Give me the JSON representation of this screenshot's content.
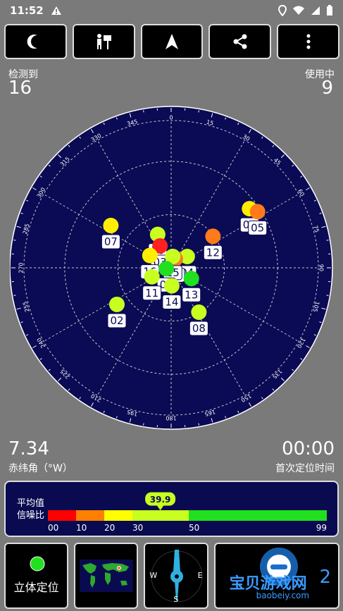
{
  "status": {
    "time": "11:52"
  },
  "stats": {
    "detected_label": "检测到",
    "detected_value": "16",
    "used_label": "使用中",
    "used_value": "9",
    "declination_value": "7.34",
    "declination_label": "赤纬角（°W）",
    "ttff_value": "00:00",
    "ttff_label": "首次定位时间"
  },
  "compass": {
    "labels": [
      "0",
      "15",
      "30",
      "45",
      "60",
      "75",
      "90",
      "105",
      "120",
      "135",
      "150",
      "165",
      "180",
      "195",
      "210",
      "225",
      "240",
      "255",
      "270",
      "285",
      "300",
      "315",
      "330",
      "345"
    ]
  },
  "satellites": [
    {
      "id": "07",
      "az": 305,
      "el": 45,
      "color": "#ffee00"
    },
    {
      "id": "09",
      "az": 53,
      "el": 30,
      "color": "#ffee00"
    },
    {
      "id": "05",
      "az": 57,
      "el": 27,
      "color": "#ff7a1a"
    },
    {
      "id": "10",
      "az": 338,
      "el": 68,
      "color": "#c8ff20"
    },
    {
      "id": "03",
      "az": 333,
      "el": 75,
      "color": "#ff2020"
    },
    {
      "id": "16",
      "az": 300,
      "el": 75,
      "color": "#ffee00"
    },
    {
      "id": "12",
      "az": 53,
      "el": 58,
      "color": "#ff7a1a"
    },
    {
      "id": "04",
      "az": 55,
      "el": 78,
      "color": "#c8ff20"
    },
    {
      "id": "06",
      "az": 25,
      "el": 84,
      "color": "#ff7a1a"
    },
    {
      "id": "15",
      "az": 8,
      "el": 83,
      "color": "#c8ff20"
    },
    {
      "id": "01",
      "az": 260,
      "el": 87,
      "color": "#20e020"
    },
    {
      "id": "11",
      "az": 245,
      "el": 77,
      "color": "#c8ff20"
    },
    {
      "id": "14",
      "az": 178,
      "el": 79,
      "color": "#c8ff20"
    },
    {
      "id": "13",
      "az": 118,
      "el": 76,
      "color": "#20e020"
    },
    {
      "id": "08",
      "az": 148,
      "el": 58,
      "color": "#c8ff20"
    },
    {
      "id": "02",
      "az": 236,
      "el": 50,
      "color": "#c8ff20"
    }
  ],
  "snr": {
    "title_line1": "平均值",
    "title_line2": "信噪比",
    "average": "39.9",
    "ticks": [
      "00",
      "10",
      "20",
      "30",
      "50",
      "99"
    ],
    "colors": [
      "#ff0000",
      "#ff8000",
      "#ffff00",
      "#c8ff20",
      "#20e020"
    ]
  },
  "bottom": {
    "stereo_label": "立体定位",
    "compass_w": "W",
    "compass_e": "E",
    "compass_s": "S",
    "watermark_text": "宝贝游戏网",
    "watermark_url": "baobeiy.com",
    "watermark_num": "2"
  }
}
